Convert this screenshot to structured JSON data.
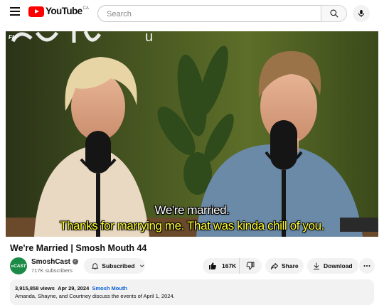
{
  "header": {
    "logo_text": "YouTube",
    "country_code": "CA",
    "search_placeholder": "Search"
  },
  "video": {
    "subtitle_line1": "We're married.",
    "subtitle_line2": "Thanks for marrying me. That was kinda chill of you.",
    "corner_mark": "FH"
  },
  "title": "We're Married | Smosh Mouth 44",
  "channel": {
    "name": "SmoshCast",
    "avatar_text": "»CAST",
    "subscribers": "717K subscribers"
  },
  "actions": {
    "subscribe_label": "Subscribed",
    "like_count": "167K",
    "share_label": "Share",
    "download_label": "Download"
  },
  "description": {
    "views": "3,915,858 views",
    "date": "Apr 29, 2024",
    "tag": "Smosh Mouth",
    "text": "Amanda, Shayne, and Courtney discuss the events of April 1, 2024."
  },
  "colors": {
    "brand_red": "#ff0000",
    "link_blue": "#065fd4",
    "subtitle_yellow": "#ffff33"
  }
}
